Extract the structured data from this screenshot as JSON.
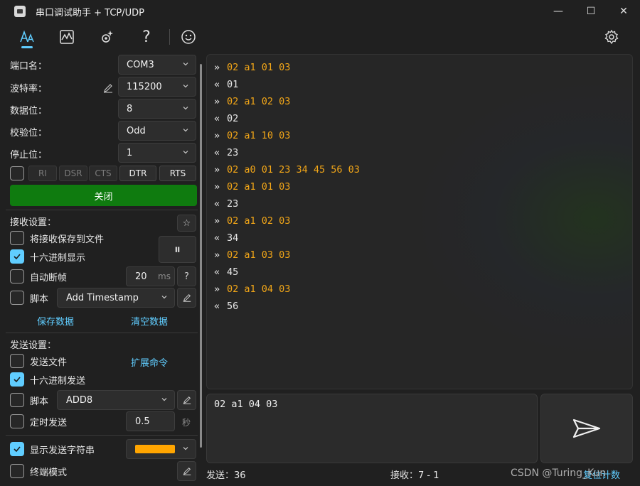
{
  "window": {
    "title": "串口调试助手 + TCP/UDP",
    "minimize_glyph": "—",
    "maximize_glyph": "☐",
    "close_glyph": "✕"
  },
  "toolbar": {
    "icons": [
      "font-icon",
      "chart-icon",
      "gear-sparkle-icon",
      "help-icon",
      "smiley-icon",
      "settings-icon"
    ],
    "help_glyph": "?",
    "smile_glyph": "☺"
  },
  "serial": {
    "port_label": "端口名：",
    "port_value": "COM3",
    "baud_label": "波特率：",
    "baud_value": "115200",
    "databits_label": "数据位：",
    "databits_value": "8",
    "parity_label": "校验位：",
    "parity_value": "Odd",
    "stopbits_label": "停止位：",
    "stopbits_value": "1",
    "pins": [
      "RI",
      "DSR",
      "CTS",
      "DTR",
      "RTS"
    ],
    "close_button": "关闭"
  },
  "receive": {
    "header": "接收设置：",
    "star": "☆",
    "save_to_file": "将接收保存到文件",
    "save_to_file_checked": false,
    "hex_display": "十六进制显示",
    "hex_display_checked": true,
    "auto_frame": "自动断帧",
    "auto_frame_checked": false,
    "auto_frame_value": "20",
    "auto_frame_unit": "ms",
    "help": "?",
    "script": "脚本",
    "script_checked": false,
    "script_value": "Add Timestamp",
    "pause": "⏸",
    "save_data": "保存数据",
    "clear_data": "清空数据"
  },
  "send": {
    "header": "发送设置：",
    "send_file": "发送文件",
    "send_file_checked": false,
    "ext_cmd": "扩展命令",
    "hex_send": "十六进制发送",
    "hex_send_checked": true,
    "script": "脚本",
    "script_checked": false,
    "script_value": "ADD8",
    "timed_send": "定时发送",
    "timed_send_checked": false,
    "timed_value": "0.5",
    "timed_unit": "秒",
    "show_send_str": "显示发送字符串",
    "show_send_str_checked": true,
    "send_color": "#ffa500",
    "terminal_mode": "终端模式",
    "terminal_mode_checked": false
  },
  "log": [
    {
      "dir": "tx",
      "arrow": "»",
      "text": "02 a1 01 03"
    },
    {
      "dir": "rx",
      "arrow": "«",
      "text": "01"
    },
    {
      "dir": "tx",
      "arrow": "»",
      "text": "02 a1 02 03"
    },
    {
      "dir": "rx",
      "arrow": "«",
      "text": "02"
    },
    {
      "dir": "tx",
      "arrow": "»",
      "text": "02 a1 10 03"
    },
    {
      "dir": "rx",
      "arrow": "«",
      "text": "23"
    },
    {
      "dir": "tx",
      "arrow": "»",
      "text": "02 a0 01 23 34 45 56 03"
    },
    {
      "dir": "tx",
      "arrow": "»",
      "text": "02 a1 01 03"
    },
    {
      "dir": "rx",
      "arrow": "«",
      "text": "23"
    },
    {
      "dir": "tx",
      "arrow": "»",
      "text": "02 a1 02 03"
    },
    {
      "dir": "rx",
      "arrow": "«",
      "text": "34"
    },
    {
      "dir": "tx",
      "arrow": "»",
      "text": "02 a1 03 03"
    },
    {
      "dir": "rx",
      "arrow": "«",
      "text": "45"
    },
    {
      "dir": "tx",
      "arrow": "»",
      "text": "02 a1 04 03"
    },
    {
      "dir": "rx",
      "arrow": "«",
      "text": "56"
    }
  ],
  "colors": {
    "tx": "#f2a618",
    "rx": "#e8e8e8",
    "accent": "#60cdff",
    "close_button": "#0f7b0f"
  },
  "send_input": "02 a1 04 03",
  "status": {
    "sent": "发送：36",
    "received": "接收：7 - 1",
    "reset": "复位计数"
  },
  "watermark": "CSDN @Turing_Kun"
}
